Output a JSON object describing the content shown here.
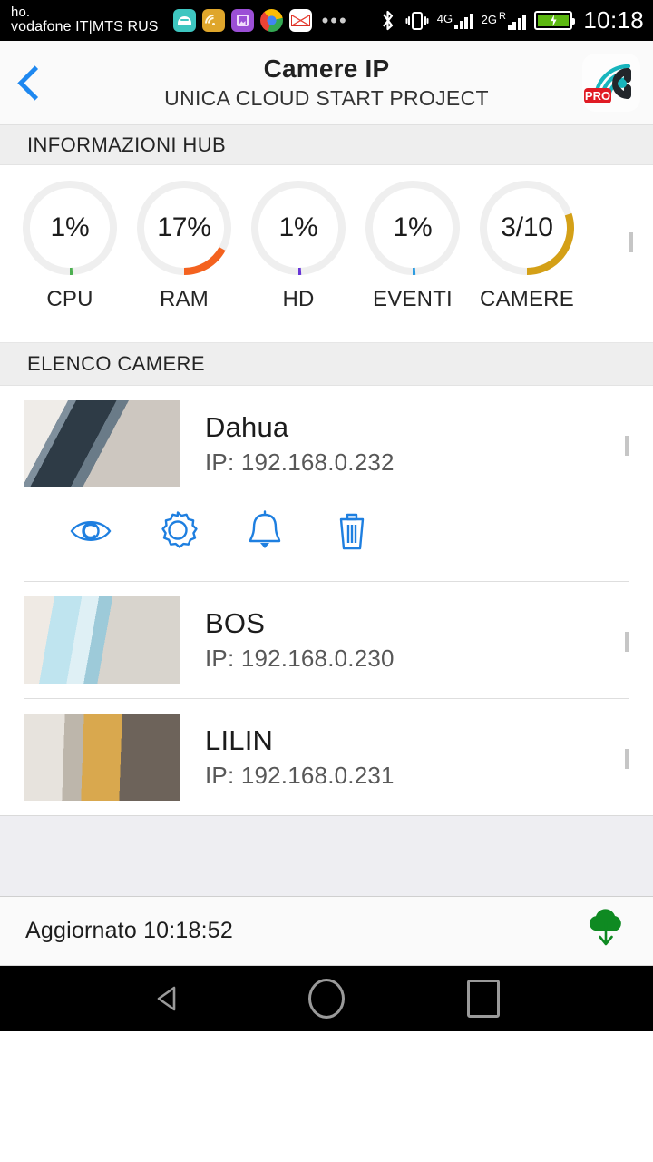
{
  "statusbar": {
    "carrier_line1": "ho.",
    "carrier_line2": "vodafone IT|MTS RUS",
    "clock": "10:18",
    "app_icons": [
      "android-icon",
      "wifi-icon",
      "photos-icon",
      "chrome-icon",
      "gmail-icon"
    ],
    "overflow": "•••",
    "bluetooth_icon": "bluetooth-icon",
    "vibrate_icon": "vibrate-icon",
    "net1_label": "4G",
    "net2_label": "2G",
    "roaming_label": "R",
    "battery_icon": "battery-charging-icon"
  },
  "appbar": {
    "back_icon": "chevron-left-icon",
    "title": "Camere IP",
    "subtitle": "UNICA CLOUD START PROJECT",
    "logo_icon": "app-logo-pro-icon",
    "logo_badge": "PRO",
    "accent": "#1e88f0"
  },
  "hub_section": {
    "header": "INFORMAZIONI HUB",
    "expand_icon": "chevron-down-icon"
  },
  "chart_data": {
    "type": "bar",
    "title": "INFORMAZIONI HUB",
    "categories": [
      "CPU",
      "RAM",
      "HD",
      "EVENTI",
      "CAMERE"
    ],
    "values": [
      1,
      17,
      1,
      1,
      30
    ],
    "display_values": [
      "1%",
      "17%",
      "1%",
      "1%",
      "3/10"
    ],
    "colors": [
      "#4CAF50",
      "#F4621F",
      "#6634D6",
      "#2C9BE0",
      "#D4A017"
    ],
    "track_color": "#efefef",
    "ylim": [
      0,
      100
    ],
    "ylabel": "",
    "xlabel": "",
    "note": "Five radial gauge rings; sweep starts at 180deg (9 o'clock) clockwise"
  },
  "camlist_section": {
    "header": "ELENCO CAMERE"
  },
  "cameras": [
    {
      "name": "Dahua",
      "ip": "IP: 192.168.0.232",
      "chevron": "chevron-up-icon",
      "expanded": true,
      "actions": [
        {
          "name": "view",
          "icon": "eye-icon"
        },
        {
          "name": "settings",
          "icon": "gear-icon"
        },
        {
          "name": "notifications",
          "icon": "bell-icon"
        },
        {
          "name": "delete",
          "icon": "trash-icon"
        }
      ]
    },
    {
      "name": "BOS",
      "ip": "IP: 192.168.0.230",
      "chevron": "chevron-down-icon",
      "expanded": false
    },
    {
      "name": "LILIN",
      "ip": "IP: 192.168.0.231",
      "chevron": "chevron-down-icon",
      "expanded": false
    }
  ],
  "footer": {
    "status": "Aggiornato 10:18:52",
    "cloud_icon": "cloud-download-icon",
    "cloud_color": "#0f8a22"
  },
  "navbar": {
    "back_icon": "nav-back-triangle-icon",
    "home_icon": "nav-home-circle-icon",
    "recents_icon": "nav-recents-square-icon"
  }
}
